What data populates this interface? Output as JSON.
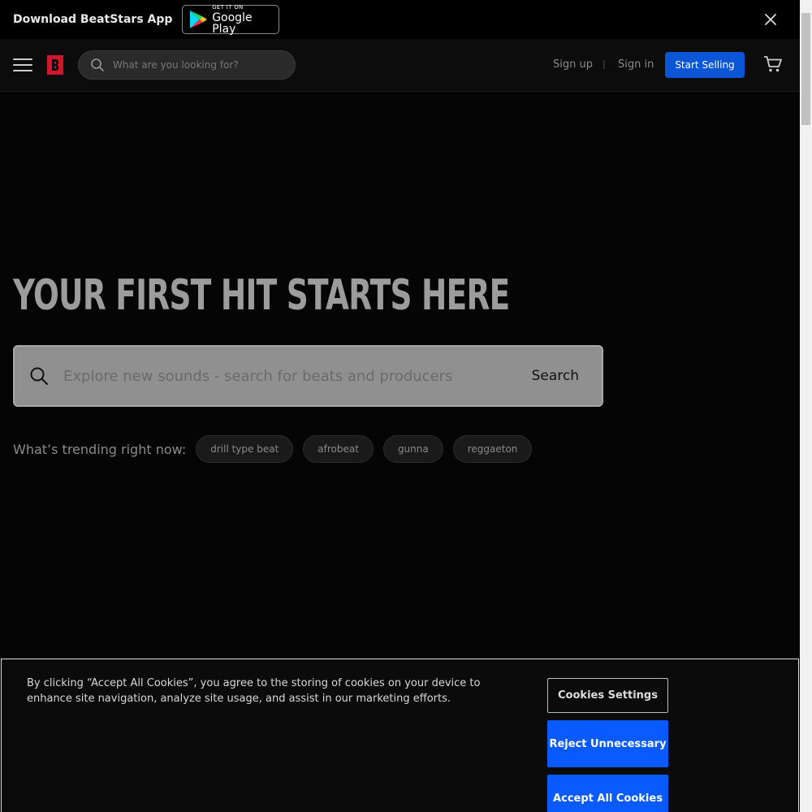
{
  "app_banner": {
    "text": "Download BeatStars App",
    "badge_small": "GET IT ON",
    "badge_big": "Google Play"
  },
  "header": {
    "search_placeholder": "What are you looking for?",
    "sign_up": "Sign up",
    "separator": "|",
    "sign_in": "Sign in",
    "start_selling": "Start Selling",
    "accent_color": "#0a56d6",
    "logo_color": "#d0162b"
  },
  "hero": {
    "title": "YOUR FIRST HIT STARTS HERE",
    "search_placeholder": "Explore new sounds - search for beats and producers",
    "search_button": "Search",
    "trending_label": "What’s trending right now:",
    "trending": [
      "drill type beat",
      "afrobeat",
      "gunna",
      "reggaeton"
    ]
  },
  "cookies": {
    "message": "By clicking “Accept All Cookies”, you agree to the storing of cookies on your device to enhance site navigation, analyze site usage, and assist in our marketing efforts.",
    "settings": "Cookies Settings",
    "reject": "Reject Unnecessary",
    "accept": "Accept All Cookies",
    "button_color": "#0a5bff"
  },
  "icons": [
    "close-icon",
    "menu-icon",
    "beatstars-logo-icon",
    "search-icon",
    "cart-icon",
    "google-play-icon"
  ]
}
